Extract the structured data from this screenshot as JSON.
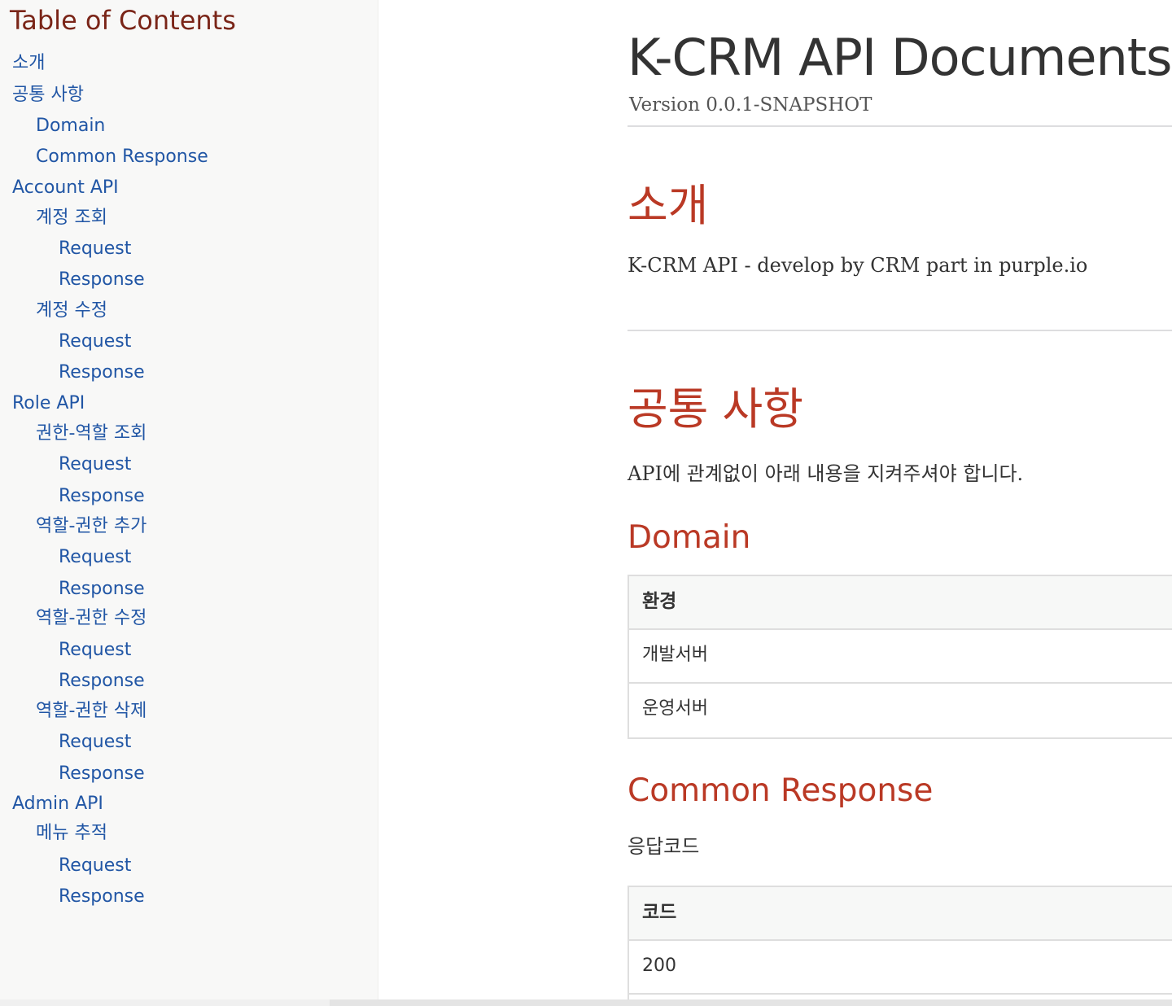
{
  "toc": {
    "title": "Table of Contents",
    "items": [
      {
        "label": "소개",
        "level": 1
      },
      {
        "label": "공통 사항",
        "level": 1
      },
      {
        "label": "Domain",
        "level": 2
      },
      {
        "label": "Common Response",
        "level": 2
      },
      {
        "label": "Account API",
        "level": 1
      },
      {
        "label": "계정 조회",
        "level": 2
      },
      {
        "label": "Request",
        "level": 3
      },
      {
        "label": "Response",
        "level": 3
      },
      {
        "label": "계정 수정",
        "level": 2
      },
      {
        "label": "Request",
        "level": 3
      },
      {
        "label": "Response",
        "level": 3
      },
      {
        "label": "Role API",
        "level": 1
      },
      {
        "label": "권한-역할 조회",
        "level": 2
      },
      {
        "label": "Request",
        "level": 3
      },
      {
        "label": "Response",
        "level": 3
      },
      {
        "label": "역할-권한 추가",
        "level": 2
      },
      {
        "label": "Request",
        "level": 3
      },
      {
        "label": "Response",
        "level": 3
      },
      {
        "label": "역할-권한 수정",
        "level": 2
      },
      {
        "label": "Request",
        "level": 3
      },
      {
        "label": "Response",
        "level": 3
      },
      {
        "label": "역할-권한 삭제",
        "level": 2
      },
      {
        "label": "Request",
        "level": 3
      },
      {
        "label": "Response",
        "level": 3
      },
      {
        "label": "Admin API",
        "level": 1
      },
      {
        "label": "메뉴 추적",
        "level": 2
      },
      {
        "label": "Request",
        "level": 3
      },
      {
        "label": "Response",
        "level": 3
      }
    ]
  },
  "doc": {
    "title": "K-CRM API Documents",
    "version": "Version 0.0.1-SNAPSHOT"
  },
  "sections": {
    "intro": {
      "heading": "소개",
      "text": "K-CRM API - develop by CRM part in purple.io"
    },
    "common": {
      "heading": "공통 사항",
      "text": "API에 관계없이 아래 내용을 지켜주셔야 합니다.",
      "domain": {
        "heading": "Domain",
        "header": "환경",
        "rows": [
          "개발서버",
          "운영서버"
        ]
      },
      "response": {
        "heading": "Common Response",
        "text": "응답코드",
        "header": "코드",
        "rows": [
          "200"
        ]
      }
    }
  },
  "colors": {
    "link": "#2156a5",
    "heading": "#ba3925",
    "toc_title": "#7a2518",
    "sidebar_bg": "#f8f8f7"
  }
}
